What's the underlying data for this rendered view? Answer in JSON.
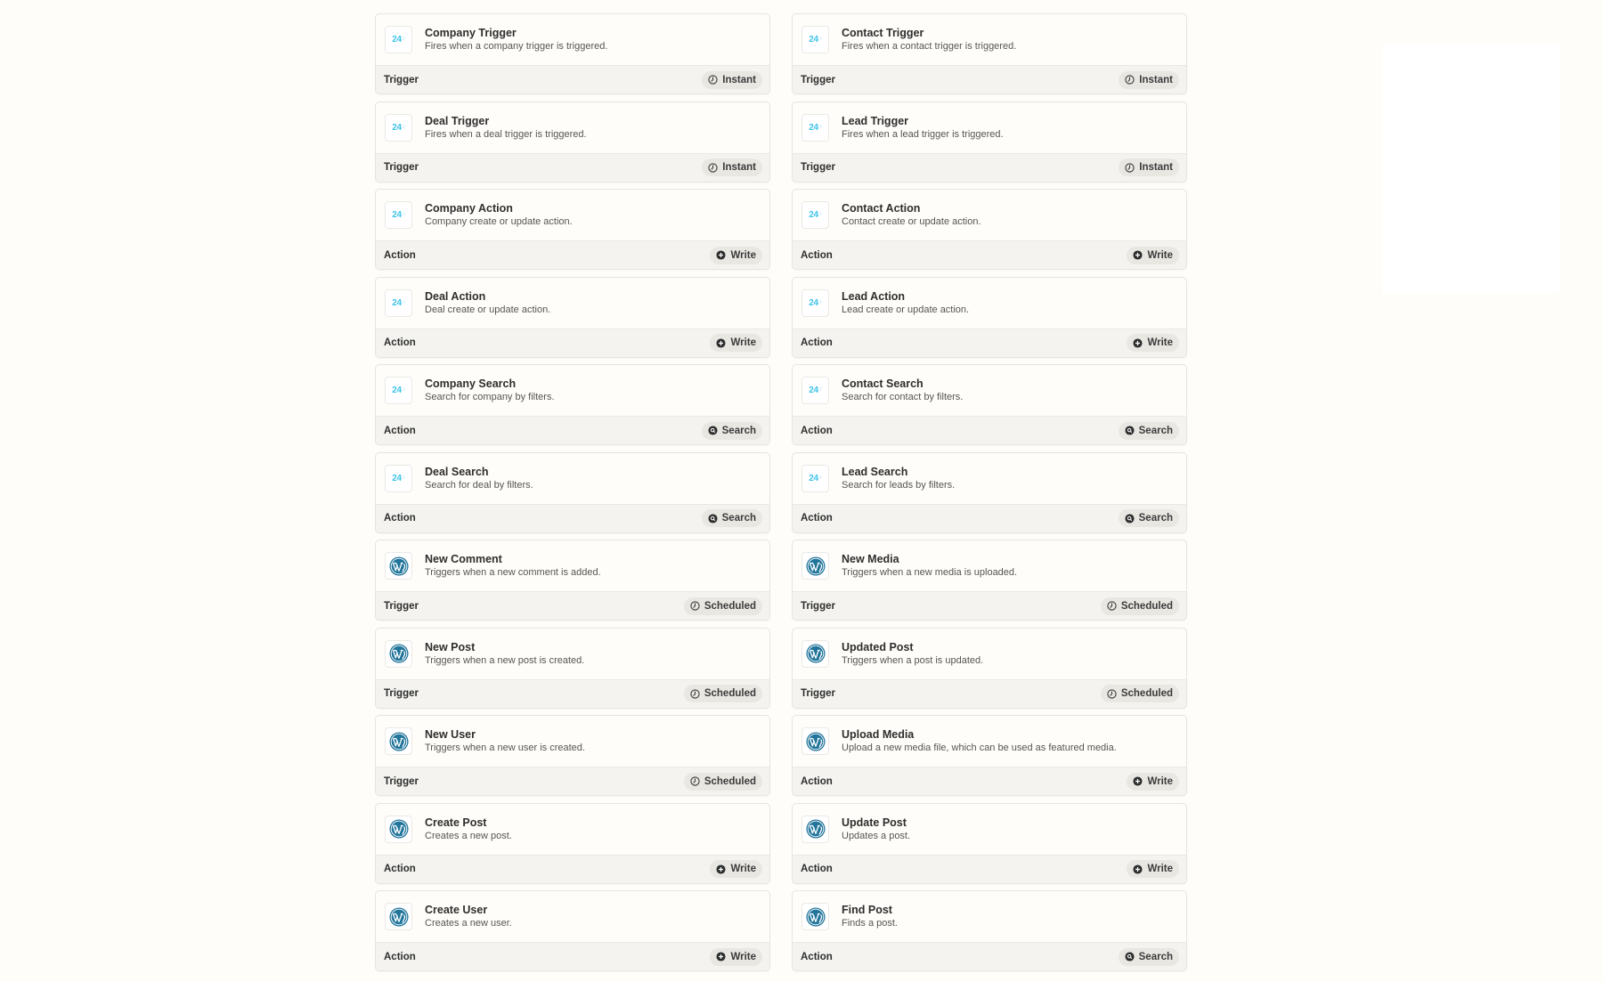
{
  "cards": [
    {
      "title": "Company Trigger",
      "desc": "Fires when a company trigger is triggered.",
      "type": "Trigger",
      "badge": "Instant",
      "badge_icon": "clock-icon",
      "logo": "24",
      "logo_icon": "bitrix24-logo"
    },
    {
      "title": "Contact Trigger",
      "desc": "Fires when a contact trigger is triggered.",
      "type": "Trigger",
      "badge": "Instant",
      "badge_icon": "clock-icon",
      "logo": "24",
      "logo_icon": "bitrix24-logo"
    },
    {
      "title": "Deal Trigger",
      "desc": "Fires when a deal trigger is triggered.",
      "type": "Trigger",
      "badge": "Instant",
      "badge_icon": "clock-icon",
      "logo": "24",
      "logo_icon": "bitrix24-logo"
    },
    {
      "title": "Lead Trigger",
      "desc": "Fires when a lead trigger is triggered.",
      "type": "Trigger",
      "badge": "Instant",
      "badge_icon": "clock-icon",
      "logo": "24",
      "logo_icon": "bitrix24-logo"
    },
    {
      "title": "Company Action",
      "desc": "Company create or update action.",
      "type": "Action",
      "badge": "Write",
      "badge_icon": "plus-circle-icon",
      "logo": "24",
      "logo_icon": "bitrix24-logo"
    },
    {
      "title": "Contact Action",
      "desc": "Contact create or update action.",
      "type": "Action",
      "badge": "Write",
      "badge_icon": "plus-circle-icon",
      "logo": "24",
      "logo_icon": "bitrix24-logo"
    },
    {
      "title": "Deal Action",
      "desc": "Deal create or update action.",
      "type": "Action",
      "badge": "Write",
      "badge_icon": "plus-circle-icon",
      "logo": "24",
      "logo_icon": "bitrix24-logo"
    },
    {
      "title": "Lead Action",
      "desc": "Lead create or update action.",
      "type": "Action",
      "badge": "Write",
      "badge_icon": "plus-circle-icon",
      "logo": "24",
      "logo_icon": "bitrix24-logo"
    },
    {
      "title": "Company Search",
      "desc": "Search for company by filters.",
      "type": "Action",
      "badge": "Search",
      "badge_icon": "search-circle-icon",
      "logo": "24",
      "logo_icon": "bitrix24-logo"
    },
    {
      "title": "Contact Search",
      "desc": "Search for contact by filters.",
      "type": "Action",
      "badge": "Search",
      "badge_icon": "search-circle-icon",
      "logo": "24",
      "logo_icon": "bitrix24-logo"
    },
    {
      "title": "Deal Search",
      "desc": "Search for deal by filters.",
      "type": "Action",
      "badge": "Search",
      "badge_icon": "search-circle-icon",
      "logo": "24",
      "logo_icon": "bitrix24-logo"
    },
    {
      "title": "Lead Search",
      "desc": "Search for leads by filters.",
      "type": "Action",
      "badge": "Search",
      "badge_icon": "search-circle-icon",
      "logo": "24",
      "logo_icon": "bitrix24-logo"
    },
    {
      "title": "New Comment",
      "desc": "Triggers when a new comment is added.",
      "type": "Trigger",
      "badge": "Scheduled",
      "badge_icon": "clock-icon",
      "logo": "W",
      "logo_icon": "wordpress-logo"
    },
    {
      "title": "New Media",
      "desc": "Triggers when a new media is uploaded.",
      "type": "Trigger",
      "badge": "Scheduled",
      "badge_icon": "clock-icon",
      "logo": "W",
      "logo_icon": "wordpress-logo"
    },
    {
      "title": "New Post",
      "desc": "Triggers when a new post is created.",
      "type": "Trigger",
      "badge": "Scheduled",
      "badge_icon": "clock-icon",
      "logo": "W",
      "logo_icon": "wordpress-logo"
    },
    {
      "title": "Updated Post",
      "desc": "Triggers when a post is updated.",
      "type": "Trigger",
      "badge": "Scheduled",
      "badge_icon": "clock-icon",
      "logo": "W",
      "logo_icon": "wordpress-logo"
    },
    {
      "title": "New User",
      "desc": "Triggers when a new user is created.",
      "type": "Trigger",
      "badge": "Scheduled",
      "badge_icon": "clock-icon",
      "logo": "W",
      "logo_icon": "wordpress-logo"
    },
    {
      "title": "Upload Media",
      "desc": "Upload a new media file, which can be used as featured media.",
      "type": "Action",
      "badge": "Write",
      "badge_icon": "plus-circle-icon",
      "logo": "W",
      "logo_icon": "wordpress-logo"
    },
    {
      "title": "Create Post",
      "desc": "Creates a new post.",
      "type": "Action",
      "badge": "Write",
      "badge_icon": "plus-circle-icon",
      "logo": "W",
      "logo_icon": "wordpress-logo"
    },
    {
      "title": "Update Post",
      "desc": "Updates a post.",
      "type": "Action",
      "badge": "Write",
      "badge_icon": "plus-circle-icon",
      "logo": "W",
      "logo_icon": "wordpress-logo"
    },
    {
      "title": "Create User",
      "desc": "Creates a new user.",
      "type": "Action",
      "badge": "Write",
      "badge_icon": "plus-circle-icon",
      "logo": "W",
      "logo_icon": "wordpress-logo"
    },
    {
      "title": "Find Post",
      "desc": "Finds a post.",
      "type": "Action",
      "badge": "Search",
      "badge_icon": "search-circle-icon",
      "logo": "W",
      "logo_icon": "wordpress-logo"
    }
  ],
  "colors": {
    "bitrix_blue": "#3ec3e8",
    "wordpress_blue": "#21759b"
  }
}
